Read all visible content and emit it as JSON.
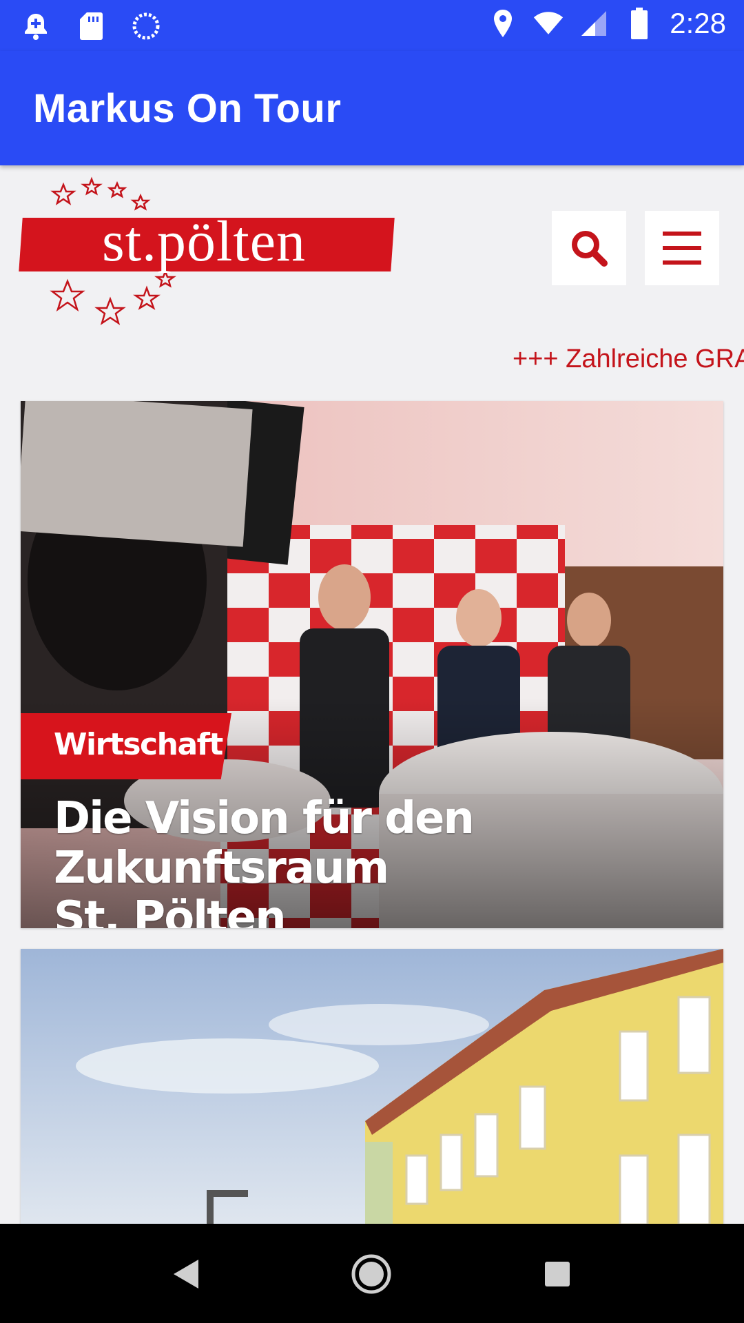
{
  "status_bar": {
    "time": "2:28",
    "left_icons": [
      "notification-add-icon",
      "sd-card-icon",
      "sync-progress-icon"
    ],
    "right_icons": [
      "location-icon",
      "wifi-icon",
      "cellular-signal-icon",
      "battery-icon"
    ]
  },
  "app_bar": {
    "title": "Markus On Tour"
  },
  "site": {
    "logo_text": "st.pölten",
    "search_button": "search-icon",
    "menu_button": "hamburger-menu-icon",
    "ticker_text": "+++ Zahlreiche GRA"
  },
  "articles": [
    {
      "category": "Wirtschaft",
      "title_line1": "Die Vision für den Zukunftsraum",
      "title_line2": "St. Pölten"
    }
  ],
  "nav_bar": {
    "buttons": [
      "back-icon",
      "home-icon",
      "recent-apps-icon"
    ]
  },
  "colors": {
    "app_bar": "#2a4bf5",
    "brand_red": "#d4141d",
    "page_bg": "#f1f1f3"
  }
}
